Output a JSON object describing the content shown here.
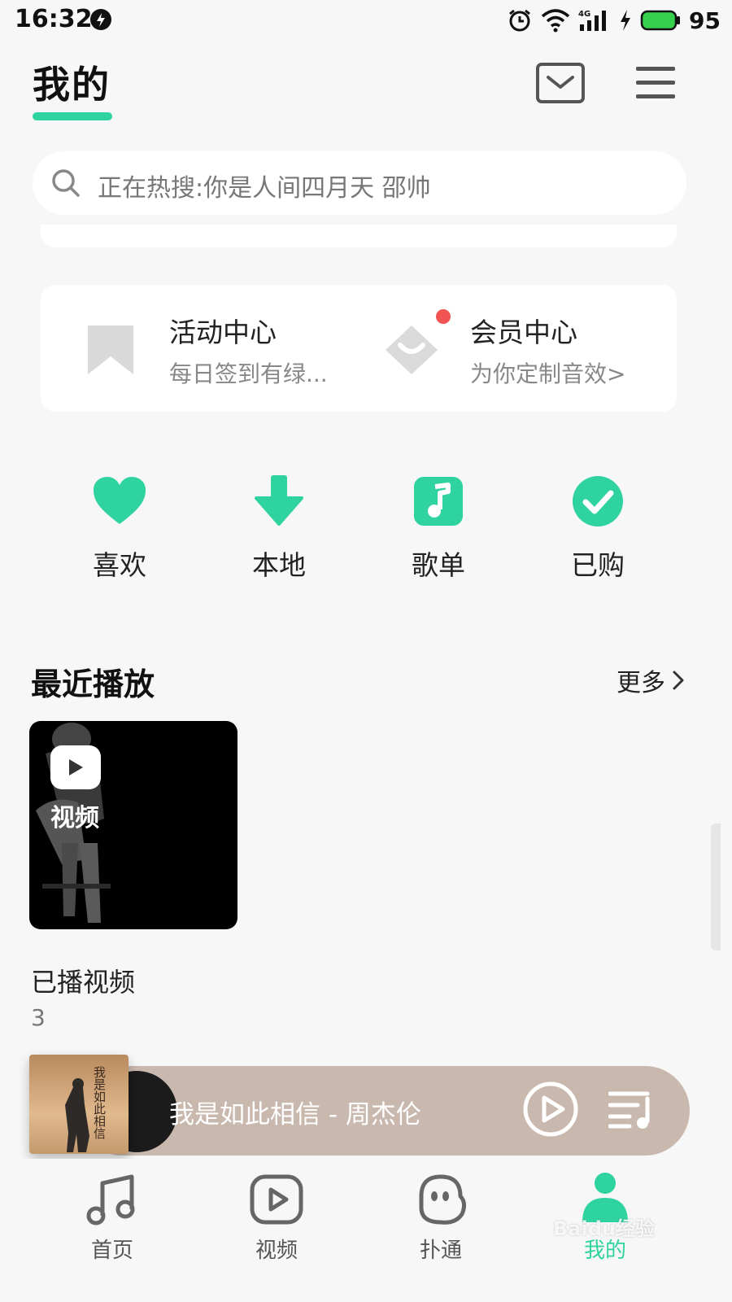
{
  "status_bar": {
    "time": "16:32",
    "network": "4G",
    "battery": "95"
  },
  "header": {
    "title": "我的",
    "accent_color": "#2fd3a0"
  },
  "search": {
    "placeholder": "正在热搜:你是人间四月天 邵帅"
  },
  "center_card": {
    "activity": {
      "title": "活动中心",
      "subtitle": "每日签到有绿..."
    },
    "vip": {
      "title": "会员中心",
      "subtitle": "为你定制音效>"
    }
  },
  "quick_entries": [
    {
      "label": "喜欢",
      "icon": "heart-icon"
    },
    {
      "label": "本地",
      "icon": "download-icon"
    },
    {
      "label": "歌单",
      "icon": "music-note-icon"
    },
    {
      "label": "已购",
      "icon": "check-circle-icon"
    }
  ],
  "recent": {
    "title": "最近播放",
    "more": "更多",
    "card_badge": "视频",
    "item_name": "已播视频",
    "item_count": "3"
  },
  "player": {
    "song": "我是如此相信 - 周杰伦",
    "cover_text": "我是如此相信",
    "bar_color": "#c9b8ae"
  },
  "tabs": [
    {
      "label": "首页",
      "icon": "music-note-icon"
    },
    {
      "label": "视频",
      "icon": "video-play-icon"
    },
    {
      "label": "扑通",
      "icon": "chat-face-icon"
    },
    {
      "label": "我的",
      "icon": "user-icon"
    }
  ],
  "watermark": "Baidu经验"
}
